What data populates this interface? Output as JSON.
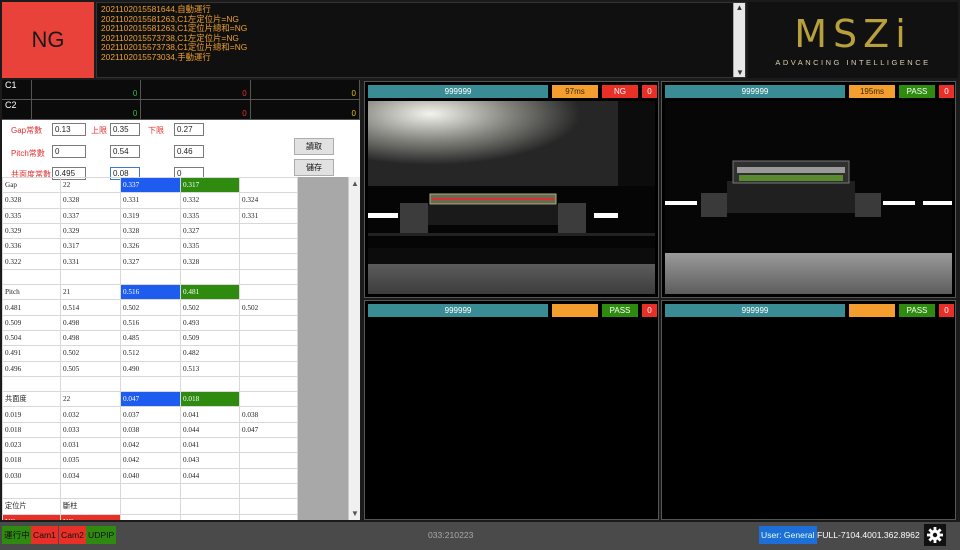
{
  "result": "NG",
  "log": [
    "2021102015581644,自動運行",
    "2021102015581263,C1左定位片=NG",
    "2021102015581263,C1定位片總和=NG",
    "2021102015573738,C1左定位片=NG",
    "2021102015573738,C1定位片總和=NG",
    "2021102015573034,手動運行"
  ],
  "logo": {
    "mark": "MSZi",
    "tagline": "ADVANCING INTELLIGENCE"
  },
  "channels": [
    {
      "label": "C1",
      "values": [
        "0",
        "0",
        "0"
      ]
    },
    {
      "label": "C2",
      "values": [
        "0",
        "0",
        "0"
      ]
    }
  ],
  "params": {
    "gap_label": "Gap常數",
    "gap_value": "0.13",
    "upper_label": "上限",
    "upper_value": "0.35",
    "lower_label": "下限",
    "lower_value": "0.27",
    "pitch_label": "Pitch常數",
    "pitch_value": "0",
    "pitch_upper": "0.54",
    "pitch_lower": "0.46",
    "coplanar_label": "共面度常數",
    "coplanar_value": "0.495",
    "coplanar_upper": "0.08",
    "coplanar_lower": "0",
    "read_btn": "讀取",
    "save_btn": "儲存"
  },
  "grid": [
    [
      "Gap",
      "22",
      "0.337",
      "0.317",
      ""
    ],
    [
      "0.328",
      "0.328",
      "0.331",
      "0.332",
      "0.324"
    ],
    [
      "0.335",
      "0.337",
      "0.319",
      "0.335",
      "0.331"
    ],
    [
      "0.329",
      "0.329",
      "0.328",
      "0.327",
      ""
    ],
    [
      "0.336",
      "0.317",
      "0.326",
      "0.335",
      ""
    ],
    [
      "0.322",
      "0.331",
      "0.327",
      "0.328",
      ""
    ],
    [
      "",
      "",
      "",
      "",
      ""
    ],
    [
      "Pitch",
      "21",
      "0.516",
      "0.481",
      ""
    ],
    [
      "0.481",
      "0.514",
      "0.502",
      "0.502",
      "0.502"
    ],
    [
      "0.509",
      "0.498",
      "0.516",
      "0.493",
      ""
    ],
    [
      "0.504",
      "0.498",
      "0.485",
      "0.509",
      ""
    ],
    [
      "0.491",
      "0.502",
      "0.512",
      "0.482",
      ""
    ],
    [
      "0.496",
      "0.505",
      "0.490",
      "0.513",
      ""
    ],
    [
      "",
      "",
      "",
      "",
      ""
    ],
    [
      "共面度",
      "22",
      "0.047",
      "0.018",
      ""
    ],
    [
      "0.019",
      "0.032",
      "0.037",
      "0.041",
      "0.038"
    ],
    [
      "0.018",
      "0.033",
      "0.038",
      "0.044",
      "0.047"
    ],
    [
      "0.023",
      "0.031",
      "0.042",
      "0.041",
      ""
    ],
    [
      "0.018",
      "0.035",
      "0.042",
      "0.043",
      ""
    ],
    [
      "0.030",
      "0.034",
      "0.040",
      "0.044",
      ""
    ],
    [
      "",
      "",
      "",
      "",
      ""
    ],
    [
      "定位片",
      "斷柱",
      "",
      "",
      ""
    ],
    [
      "NG",
      "NG",
      "",
      "",
      ""
    ]
  ],
  "cams": [
    {
      "id": "999999",
      "time": "97ms",
      "status": "NG",
      "count": "0"
    },
    {
      "id": "999999",
      "time": "195ms",
      "status": "PASS",
      "count": "0"
    },
    {
      "id": "999999",
      "time": "",
      "status": "PASS",
      "count": "0"
    },
    {
      "id": "999999",
      "time": "",
      "status": "PASS",
      "count": "0"
    }
  ],
  "status_bar": {
    "running": "運行中",
    "cam1": "Cam1",
    "cam2": "Cam2",
    "udpip": "UDPIP",
    "code": "033:210223",
    "user": "User: General",
    "version": "FULL-7104.4001.362.8962"
  },
  "colors": {
    "ng": "#e8423a",
    "pass": "#2e8b10",
    "accent_blue": "#1e5cf0",
    "log_text": "#f0a030",
    "cam_header": "#3a8c94"
  },
  "icons": {
    "settings": "gear-icon",
    "scroll_up": "chevron-up-icon",
    "scroll_down": "chevron-down-icon"
  }
}
